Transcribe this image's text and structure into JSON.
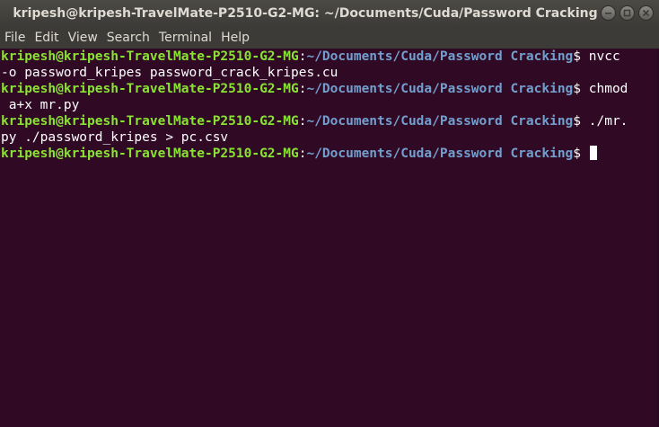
{
  "window": {
    "title": "kripesh@kripesh-TravelMate-P2510-G2-MG: ~/Documents/Cuda/Password Cracking"
  },
  "controls": {
    "minimize_icon": "minimize-icon",
    "maximize_icon": "maximize-icon",
    "close_icon": "close-icon"
  },
  "menu": {
    "items": [
      "File",
      "Edit",
      "View",
      "Search",
      "Terminal",
      "Help"
    ]
  },
  "terminal": {
    "colors": {
      "background": "#300a24",
      "user": "#8ae234",
      "path": "#729fcf",
      "text": "#ffffff"
    },
    "prompt_user": "kripesh@kripesh-TravelMate-P2510-G2-MG",
    "prompt_sep": ":",
    "prompt_path": "~/Documents/Cuda/Password Cracking",
    "prompt_dollar": "$ ",
    "entries": [
      {
        "command_head": "nvcc",
        "command_tail": "-o password_kripes password_crack_kripes.cu"
      },
      {
        "command_head": "chmod",
        "command_tail": " a+x mr.py"
      },
      {
        "command_head": "./mr.",
        "command_tail": "py ./password_kripes > pc.csv"
      }
    ]
  }
}
